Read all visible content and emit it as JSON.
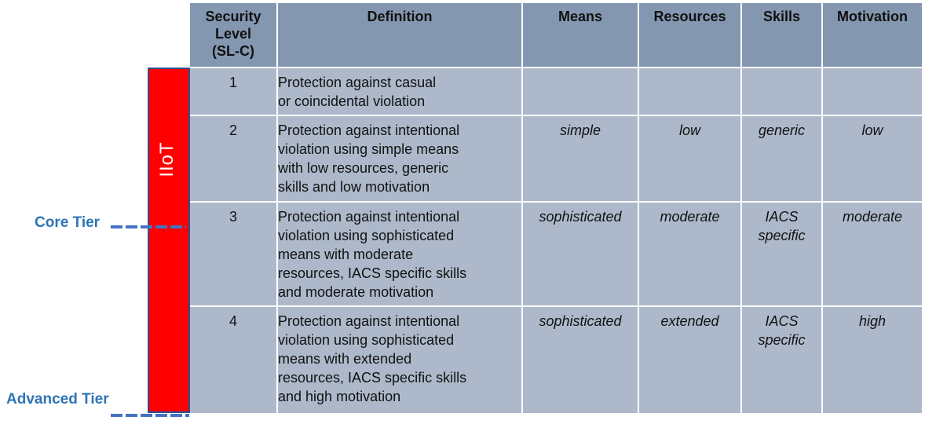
{
  "side_annotations": {
    "bar_label": "IIoT",
    "core_tier": "Core Tier",
    "advanced_tier": "Advanced Tier",
    "bar_color": "#ff0000",
    "tier_label_color": "#2e75b6"
  },
  "table": {
    "headers": [
      "Security Level (SL-C)",
      "Definition",
      "Means",
      "Resources",
      "Skills",
      "Motivation"
    ],
    "header_lines": {
      "security_level": [
        "Security",
        "Level",
        "(SL-C)"
      ]
    },
    "rows": [
      {
        "level": "1",
        "definition": "Protection against casual or coincidental violation",
        "means": "",
        "resources": "",
        "skills": "",
        "motivation": ""
      },
      {
        "level": "2",
        "definition": "Protection against intentional violation using simple means with low resources, generic skills and low motivation",
        "means": "simple",
        "resources": "low",
        "skills": "generic",
        "motivation": "low"
      },
      {
        "level": "3",
        "definition": "Protection against intentional violation using sophisticated means with moderate resources, IACS specific skills and moderate motivation",
        "means": "sophisticated",
        "resources": "moderate",
        "skills": "IACS specific",
        "motivation": "moderate"
      },
      {
        "level": "4",
        "definition": "Protection against intentional violation using sophisticated means with extended resources, IACS specific skills and high motivation",
        "means": "sophisticated",
        "resources": "extended",
        "skills": "IACS specific",
        "motivation": "high"
      }
    ],
    "definition_lines": [
      [
        "Protection against casual",
        "or coincidental violation"
      ],
      [
        "Protection against intentional",
        "violation using simple means",
        "with low resources, generic",
        "skills and low motivation"
      ],
      [
        "Protection against intentional",
        "violation using sophisticated",
        "means with moderate",
        "resources, IACS specific skills",
        "and moderate motivation"
      ],
      [
        "Protection against intentional",
        "violation using sophisticated",
        "means with extended",
        "resources, IACS specific skills",
        "and high motivation"
      ]
    ],
    "skills_lines": [
      [],
      [],
      [
        "IACS",
        "specific"
      ],
      [
        "IACS",
        "specific"
      ]
    ],
    "header_color": "#8497b0",
    "cell_color": "#adb9ca"
  }
}
